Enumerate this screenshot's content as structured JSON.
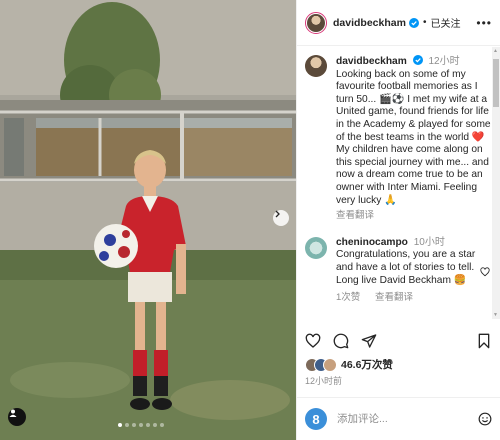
{
  "post": {
    "image_alt": "Young boy in red football kit holding a football on grass",
    "carousel": {
      "count": 7,
      "active_index": 0
    }
  },
  "header": {
    "username": "davidbeckham",
    "separator": "•",
    "follow_status": "已关注",
    "more": "•••"
  },
  "caption": {
    "username": "davidbeckham",
    "time": "12小时",
    "text": "Looking back on some of my favourite football memories as I turn 50... 🎬⚽ I met my wife at a United game, found friends for life in the Academy & played for some of the best teams in the world ❤️ My children have come along on this special journey with me... and now a dream come true to be an owner with Inter Miami. Feeling very lucky 🙏",
    "translate": "查看翻译"
  },
  "comment": {
    "username": "chenino­campo",
    "time": "10小时",
    "text": "Congratulations, you are a star and have a lot of stories to tell. Long live David Beckham 🍔",
    "likes": "1次赞",
    "translate": "查看翻译"
  },
  "stats": {
    "likes": "46.6万次赞",
    "posted": "12小时前"
  },
  "add_comment": {
    "avatar_letter": "8",
    "placeholder": "添加评论..."
  },
  "colors": {
    "verified": "#0095f6",
    "heart": "#ed4956",
    "text": "#262626",
    "muted": "#8e8e8e"
  }
}
